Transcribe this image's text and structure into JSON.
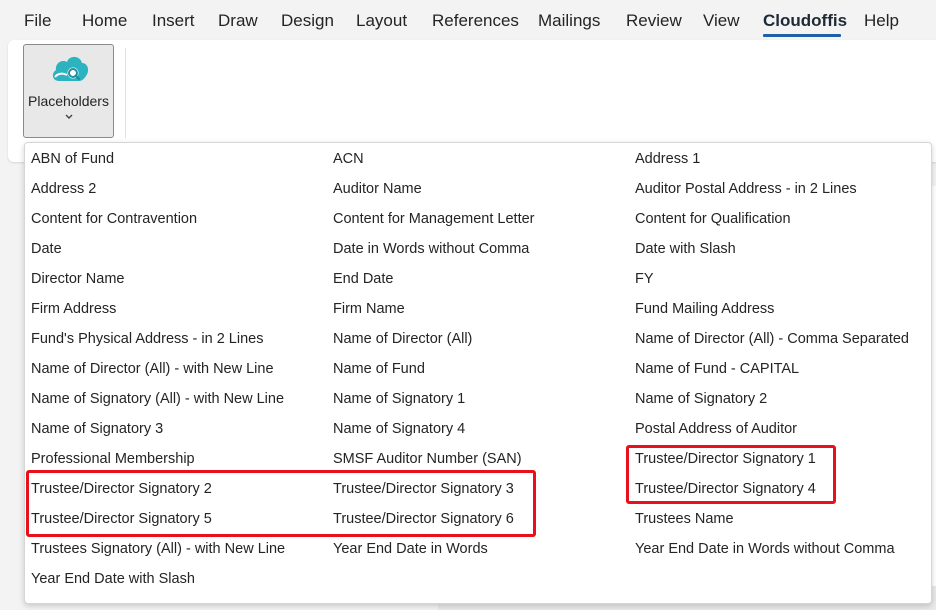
{
  "menu": {
    "tabs": [
      "File",
      "Home",
      "Insert",
      "Draw",
      "Design",
      "Layout",
      "References",
      "Mailings",
      "Review",
      "View",
      "Cloudoffis",
      "Help"
    ],
    "active": "Cloudoffis"
  },
  "ribbon": {
    "placeholders_label": "Placeholders"
  },
  "dropdown": {
    "columns": [
      [
        "ABN of Fund",
        "Address 2",
        "Content for Contravention",
        "Date",
        "Director Name",
        "Firm Address",
        "Fund's Physical Address - in 2 Lines",
        "Name of Director (All) - with New Line",
        "Name of Signatory (All) - with New Line",
        "Name of Signatory 3",
        "Professional Membership",
        "Trustee/Director Signatory 2",
        "Trustee/Director Signatory 5",
        "Trustees Signatory (All) - with New Line",
        "Year End Date with Slash"
      ],
      [
        "ACN",
        "Auditor Name",
        "Content for Management Letter",
        "Date in Words without Comma",
        "End Date",
        "Firm Name",
        "Name of Director (All)",
        "Name of Fund",
        "Name of Signatory 1",
        "Name of Signatory 4",
        "SMSF Auditor Number (SAN)",
        "Trustee/Director Signatory 3",
        "Trustee/Director Signatory 6",
        "Year End Date in Words"
      ],
      [
        "Address 1",
        "Auditor Postal Address - in 2 Lines",
        "Content for Qualification",
        "Date with Slash",
        "FY",
        "Fund Mailing Address",
        "Name of Director (All) - Comma Separated",
        "Name of Fund - CAPITAL",
        "Name of Signatory 2",
        "Postal Address of Auditor",
        "Trustee/Director Signatory 1",
        "Trustee/Director Signatory 4",
        "Trustees Name",
        "Year End Date in Words without Comma"
      ]
    ]
  },
  "colors": {
    "accent": "#1f5fa8",
    "highlight": "#e8101a",
    "cloud_teal": "#2bb3c0"
  }
}
